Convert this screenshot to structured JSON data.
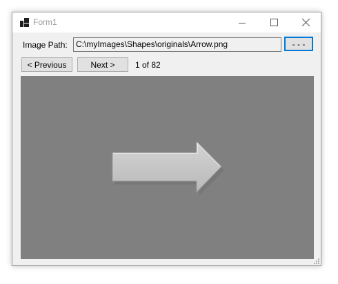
{
  "window": {
    "title": "Form1",
    "icon": "windows-forms-app-icon",
    "controls": {
      "minimize_icon": "minimize-icon",
      "maximize_icon": "maximize-icon",
      "close_icon": "close-icon"
    }
  },
  "form": {
    "path_label": "Image Path:",
    "path_value": "C:\\myImages\\Shapes\\originals\\Arrow.png",
    "browse_label": "- - -",
    "prev_label": "< Previous",
    "next_label": "Next >",
    "counter": "1 of 82"
  },
  "picture": {
    "background": "#808080",
    "content": "right-arrow-image",
    "arrow_color": "#c8c8c8"
  },
  "colors": {
    "accent": "#0078d7",
    "form_bg": "#f0f0f0"
  }
}
